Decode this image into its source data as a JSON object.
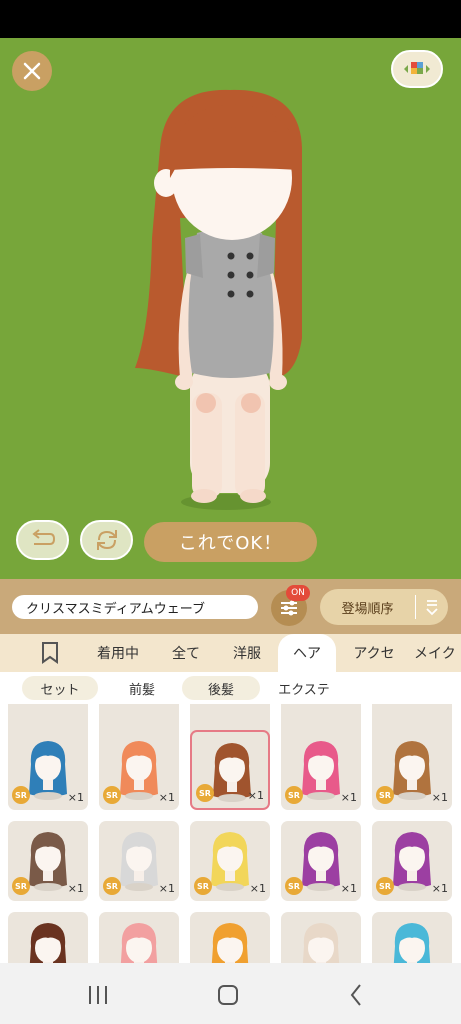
{
  "stage": {
    "ok_label": "これでOK！"
  },
  "toolbar": {
    "search_value": "クリスマスミディアムウェーブ",
    "filter_badge": "ON",
    "sort_label": "登場順序"
  },
  "tabs": [
    {
      "label": "着用中"
    },
    {
      "label": "全て"
    },
    {
      "label": "洋服"
    },
    {
      "label": "ヘア"
    },
    {
      "label": "アクセ"
    },
    {
      "label": "メイク"
    }
  ],
  "subtabs": [
    {
      "label": "セット"
    },
    {
      "label": "前髪"
    },
    {
      "label": "後髪"
    },
    {
      "label": "エクステ"
    }
  ],
  "items": {
    "rarity": "SR",
    "count": "×1",
    "hair_colors": [
      "#2f7fb8",
      "#f08a5a",
      "#a0542e",
      "#e85a8a",
      "#b0733e",
      "#7a5a48",
      "#d8d8d8",
      "#f2d65a",
      "#9c3fa2",
      "#9c3fa2",
      "#6a3320",
      "#f2a0a0",
      "#f0a030",
      "#e8d8c8",
      "#4ab8d8"
    ]
  },
  "colors": {
    "stage_bg": "#77a63a",
    "accent": "#c9a063",
    "selected_border": "#e67a86"
  }
}
